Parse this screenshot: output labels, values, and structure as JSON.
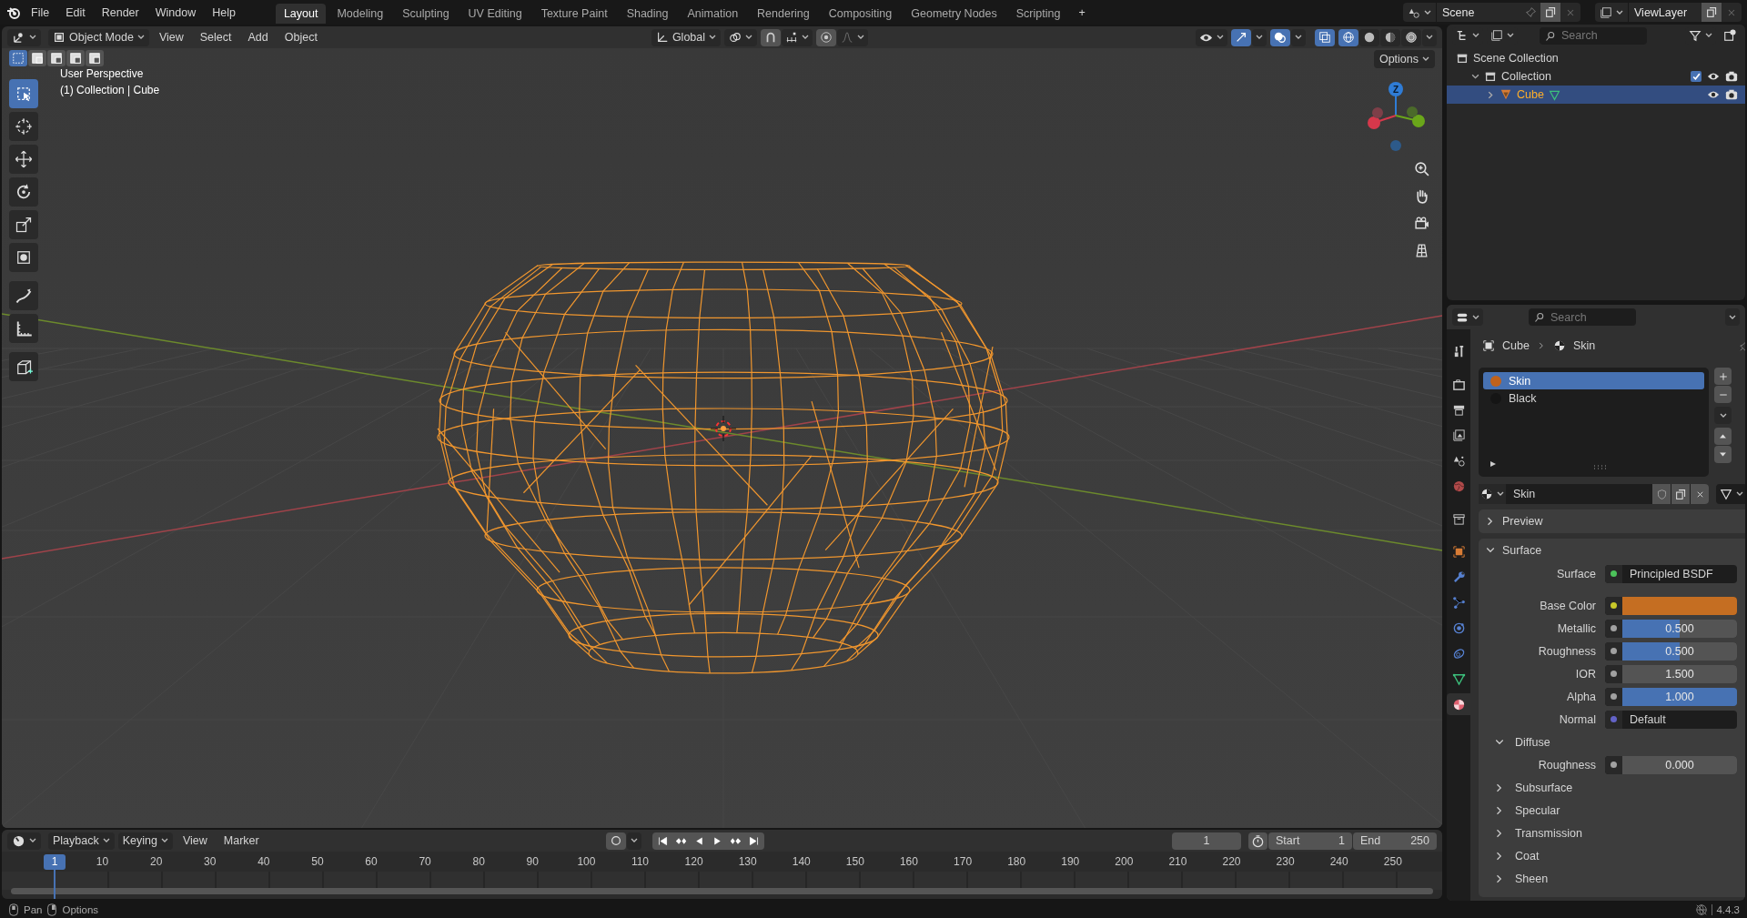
{
  "menu": [
    "File",
    "Edit",
    "Render",
    "Window",
    "Help"
  ],
  "workspaces": [
    {
      "label": "Layout",
      "selected": true
    },
    {
      "label": "Modeling",
      "selected": false
    },
    {
      "label": "Sculpting",
      "selected": false
    },
    {
      "label": "UV Editing",
      "selected": false
    },
    {
      "label": "Texture Paint",
      "selected": false
    },
    {
      "label": "Shading",
      "selected": false
    },
    {
      "label": "Animation",
      "selected": false
    },
    {
      "label": "Rendering",
      "selected": false
    },
    {
      "label": "Compositing",
      "selected": false
    },
    {
      "label": "Geometry Nodes",
      "selected": false
    },
    {
      "label": "Scripting",
      "selected": false
    }
  ],
  "add_workspace": "+",
  "scene": "Scene",
  "view_layer": "ViewLayer",
  "viewport": {
    "mode": "Object Mode",
    "menus": [
      "View",
      "Select",
      "Add",
      "Object"
    ],
    "orientation": "Global",
    "options": "Options",
    "overlay_text": [
      "User Perspective",
      "(1) Collection | Cube"
    ],
    "select_modes": [
      {
        "selected": true
      },
      {
        "selected": false
      },
      {
        "selected": false
      },
      {
        "selected": false
      },
      {
        "selected": false
      }
    ],
    "tools": [
      {
        "selected": true
      },
      {
        "selected": false
      },
      {
        "selected": false
      },
      {
        "selected": false
      },
      {
        "selected": false
      },
      {
        "selected": false
      },
      {
        "selected": false
      },
      {
        "selected": false
      },
      {
        "selected": false
      }
    ],
    "shading": [
      {
        "selected": true
      },
      {
        "selected": false
      },
      {
        "selected": false
      },
      {
        "selected": false
      }
    ],
    "gizmo_axis": "Z"
  },
  "outliner": {
    "search": {
      "placeholder": "Search"
    },
    "tree": [
      {
        "label": "Scene Collection",
        "children": [
          {
            "label": "Collection",
            "expanded": true,
            "checked": true,
            "selected": false,
            "children": [
              {
                "label": "Cube",
                "expanded": false,
                "selected": true
              }
            ]
          }
        ]
      }
    ]
  },
  "properties": {
    "search": {
      "placeholder": "Search"
    },
    "breadcrumb": [
      "Cube",
      "Skin"
    ],
    "tabs": [
      {
        "selected": false
      },
      {
        "selected": false
      },
      {
        "selected": false
      },
      {
        "selected": false
      },
      {
        "selected": false
      },
      {
        "selected": false
      },
      {
        "selected": false
      },
      {
        "selected": false
      },
      {
        "selected": false
      },
      {
        "selected": false
      },
      {
        "selected": false
      },
      {
        "selected": false
      },
      {
        "selected": false
      },
      {
        "selected": true
      }
    ],
    "slots": [
      {
        "name": "Skin",
        "selected": true,
        "color": "#c0621c"
      },
      {
        "name": "Black",
        "selected": false,
        "color": "#151515"
      }
    ],
    "material": "Skin",
    "panels": [
      {
        "label": "Preview",
        "expanded": false
      },
      {
        "label": "Surface",
        "expanded": true
      }
    ],
    "fields": [
      {
        "kind": "shader",
        "label": "Surface",
        "value": "Principled BSDF"
      },
      {
        "kind": "color",
        "label": "Base Color",
        "color": "#c56e22"
      },
      {
        "kind": "slider",
        "label": "Metallic",
        "value": "0.500",
        "level": 0.5
      },
      {
        "kind": "slider",
        "label": "Roughness",
        "value": "0.500",
        "level": 0.5
      },
      {
        "kind": "number",
        "label": "IOR",
        "value": "1.500"
      },
      {
        "kind": "slider",
        "label": "Alpha",
        "value": "1.000",
        "level": 1
      },
      {
        "kind": "vector",
        "label": "Normal",
        "value": "Default"
      }
    ],
    "sections": [
      {
        "label": "Diffuse",
        "expanded": true,
        "fields": [
          {
            "kind": "number",
            "label": "Roughness",
            "value": "0.000"
          }
        ]
      },
      {
        "label": "Subsurface",
        "expanded": false
      },
      {
        "label": "Specular",
        "expanded": false
      },
      {
        "label": "Transmission",
        "expanded": false
      },
      {
        "label": "Coat",
        "expanded": false
      },
      {
        "label": "Sheen",
        "expanded": false
      }
    ]
  },
  "timeline": {
    "menus": [
      "Playback",
      "Keying",
      "View",
      "Marker"
    ],
    "current_frame": "1",
    "start_label": "Start",
    "start": "1",
    "end_label": "End",
    "end": "250",
    "playhead": "1",
    "ticks": [
      "10",
      "20",
      "30",
      "40",
      "50",
      "60",
      "70",
      "80",
      "90",
      "100",
      "110",
      "120",
      "130",
      "140",
      "150",
      "160",
      "170",
      "180",
      "190",
      "200",
      "210",
      "220",
      "230",
      "240",
      "250"
    ]
  },
  "status_bar": {
    "hints": [
      "Pan",
      "Options"
    ],
    "version": "4.4.3"
  }
}
